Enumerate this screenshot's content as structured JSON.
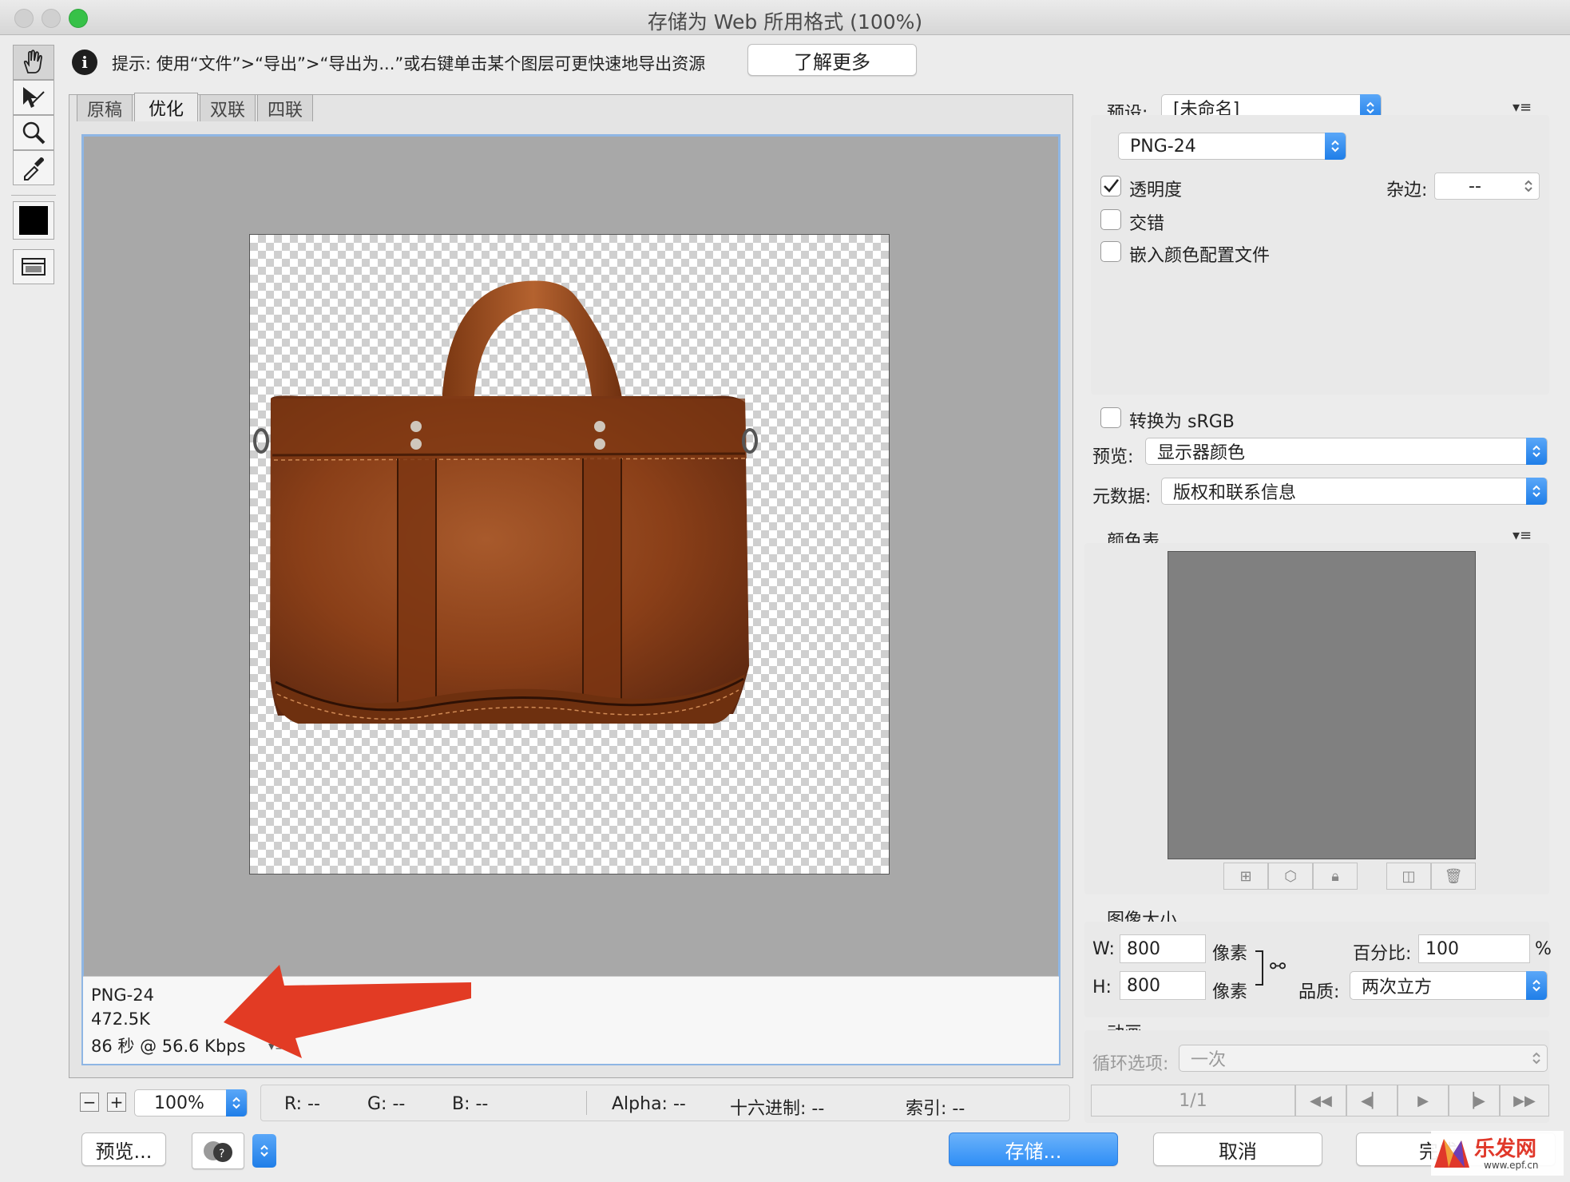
{
  "window": {
    "title": "存储为 Web 所用格式 (100%)"
  },
  "hint": {
    "text": "提示: 使用“文件”>“导出”>“导出为...”或右键单击某个图层可更快速地导出资源",
    "learn_more": "了解更多"
  },
  "tools": [
    "hand-tool",
    "slice-select-tool",
    "zoom-tool",
    "eyedropper-tool"
  ],
  "tabs": [
    "原稿",
    "优化",
    "双联",
    "四联"
  ],
  "image_info": {
    "format": "PNG-24",
    "size": "472.5K",
    "time": "86 秒 @ 56.6 Kbps"
  },
  "zoom": {
    "value": "100%"
  },
  "pixel_info": {
    "r": "R: --",
    "g": "G: --",
    "b": "B: --",
    "alpha": "Alpha: --",
    "hex": "十六进制: --",
    "index": "索引: --"
  },
  "bottom_buttons": {
    "preview": "预览...",
    "save": "存储...",
    "cancel": "取消",
    "done": "完成"
  },
  "settings": {
    "preset_label": "预设:",
    "preset_value": "[未命名]",
    "format_value": "PNG-24",
    "transparency": {
      "label": "透明度",
      "checked": true
    },
    "matte_label": "杂边:",
    "matte_value": "--",
    "interlaced": {
      "label": "交错",
      "checked": false
    },
    "embed_profile": {
      "label": "嵌入颜色配置文件",
      "checked": false
    },
    "convert_srgb": {
      "label": "转换为 sRGB",
      "checked": false
    },
    "preview_label": "预览:",
    "preview_value": "显示器颜色",
    "metadata_label": "元数据:",
    "metadata_value": "版权和联系信息"
  },
  "color_table": {
    "title": "颜色表"
  },
  "image_size": {
    "title": "图像大小",
    "w_label": "W:",
    "w_value": "800",
    "w_unit": "像素",
    "h_label": "H:",
    "h_value": "800",
    "h_unit": "像素",
    "percent_label": "百分比:",
    "percent_value": "100",
    "percent_unit": "%",
    "quality_label": "品质:",
    "quality_value": "两次立方"
  },
  "animation": {
    "title": "动画",
    "loop_label": "循环选项:",
    "loop_value": "一次",
    "frame": "1/1"
  },
  "watermark": {
    "text": "乐发网",
    "url": "www.epf.cn"
  },
  "colors": {
    "accent": "#2f8ef6",
    "bag": "#8a3d17",
    "arrow": "#e23b24",
    "canvas_bg": "#a8a8a8"
  }
}
